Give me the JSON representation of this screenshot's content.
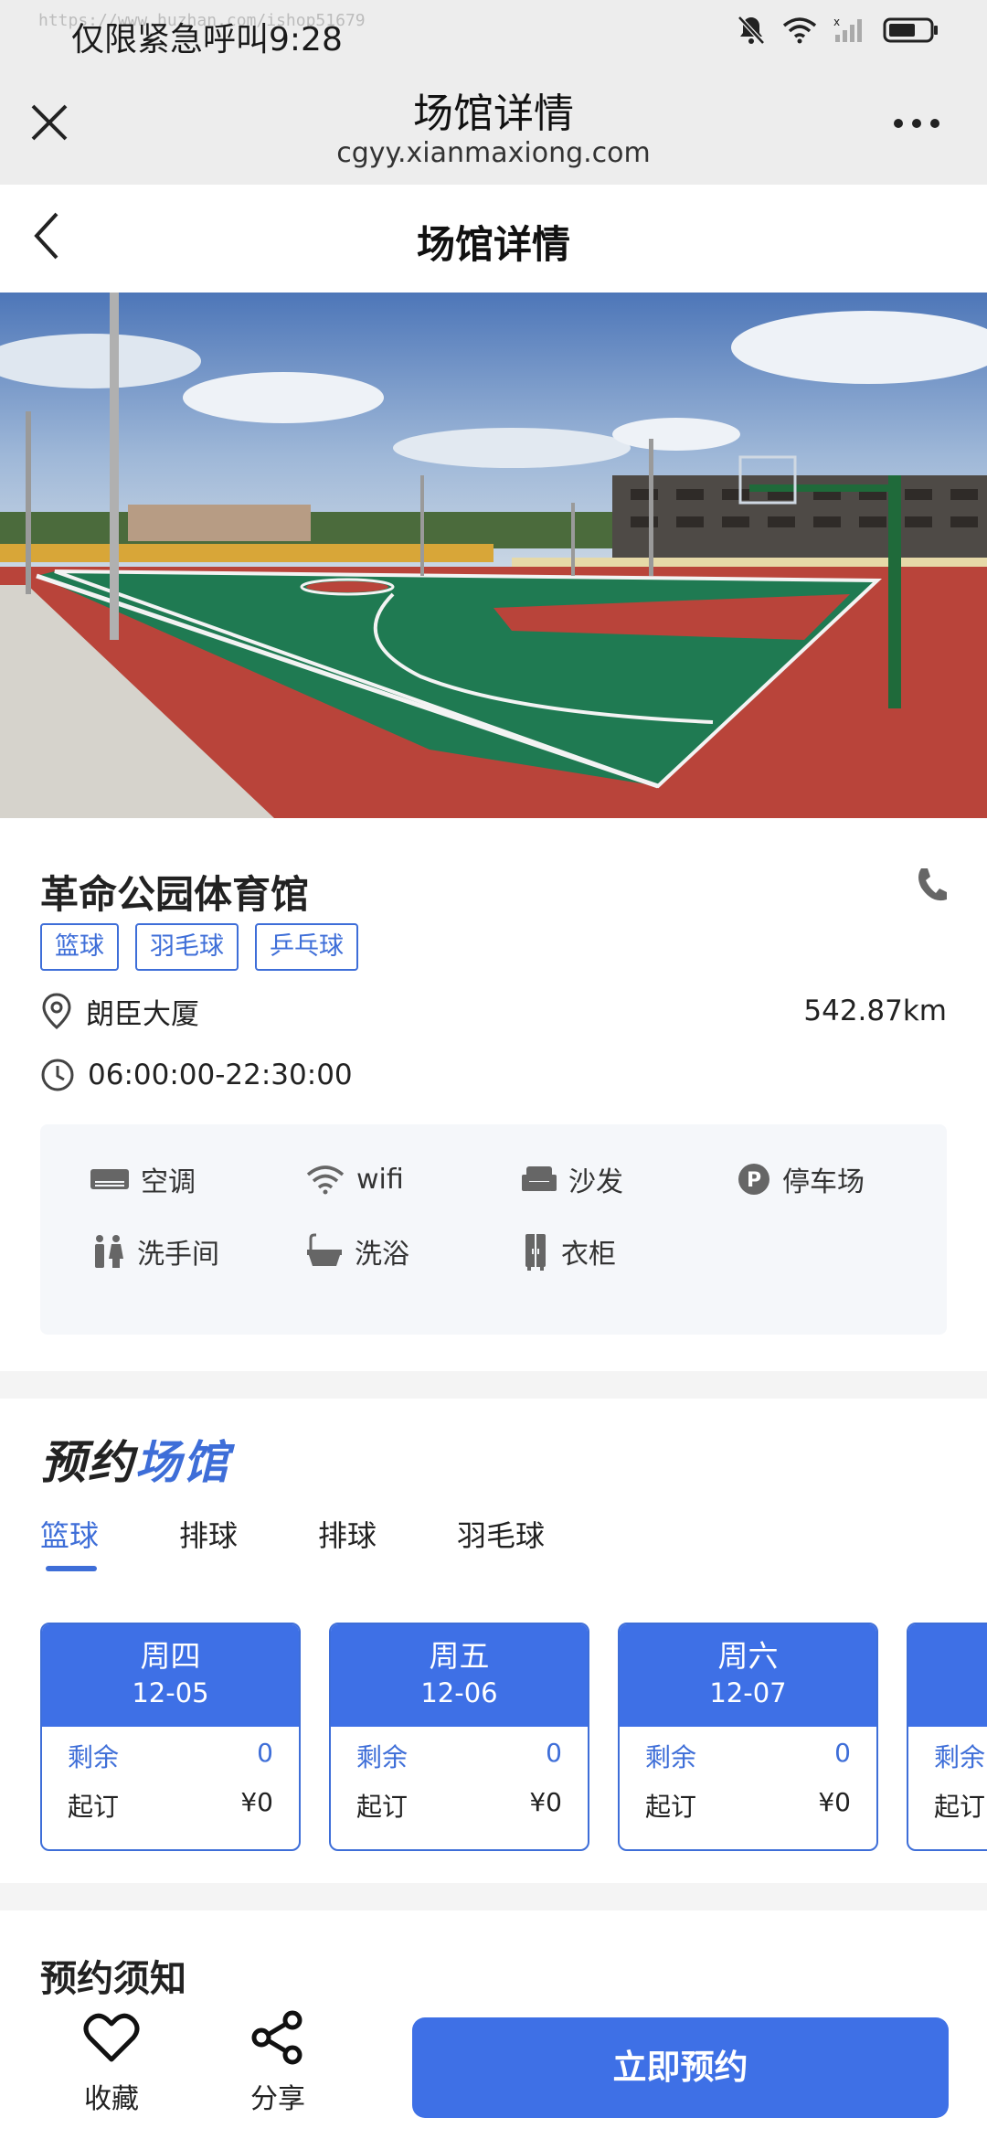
{
  "status_bar": {
    "watermark": "https://www.huzhan.com/ishop51679",
    "left_text": "仅限紧急呼叫9:28",
    "icons": [
      "bell-muted-icon",
      "wifi-icon",
      "signal-icon",
      "battery-icon"
    ]
  },
  "browser": {
    "title": "场馆详情",
    "url": "cgyy.xianmaxiong.com",
    "close_icon": "close-icon",
    "more_icon": "more-icon"
  },
  "page": {
    "title": "场馆详情",
    "back_icon": "chevron-left-icon"
  },
  "venue": {
    "name": "革命公园体育馆",
    "tags": [
      "篮球",
      "羽毛球",
      "乒乓球"
    ],
    "address": "朗臣大厦",
    "distance": "542.87km",
    "hours": "06:00:00-22:30:00",
    "amenities": [
      {
        "label": "空调",
        "icon": "air-conditioner-icon"
      },
      {
        "label": "wifi",
        "icon": "wifi-icon"
      },
      {
        "label": "沙发",
        "icon": "sofa-icon"
      },
      {
        "label": "停车场",
        "icon": "parking-icon"
      },
      {
        "label": "洗手间",
        "icon": "restroom-icon"
      },
      {
        "label": "洗浴",
        "icon": "bathtub-icon"
      },
      {
        "label": "衣柜",
        "icon": "wardrobe-icon"
      }
    ]
  },
  "booking": {
    "heading_part1": "预约",
    "heading_part2": "场馆",
    "tabs": [
      "篮球",
      "排球",
      "排球",
      "羽毛球"
    ],
    "active_tab": 0,
    "days": [
      {
        "weekday": "周四",
        "date": "12-05",
        "remain_label": "剩余",
        "remain": "0",
        "start_label": "起订",
        "price": "¥0"
      },
      {
        "weekday": "周五",
        "date": "12-06",
        "remain_label": "剩余",
        "remain": "0",
        "start_label": "起订",
        "price": "¥0"
      },
      {
        "weekday": "周六",
        "date": "12-07",
        "remain_label": "剩余",
        "remain": "0",
        "start_label": "起订",
        "price": "¥0"
      },
      {
        "weekday": "",
        "date": "",
        "remain_label": "剩余",
        "remain": "",
        "start_label": "起订",
        "price": ""
      }
    ]
  },
  "notice": {
    "title": "预约须知"
  },
  "actions": {
    "favorite_label": "收藏",
    "share_label": "分享",
    "book_label": "立即预约"
  },
  "colors": {
    "accent": "#3e70e6",
    "tag_blue": "#3e6ed8",
    "bar_bg": "#ededed"
  }
}
